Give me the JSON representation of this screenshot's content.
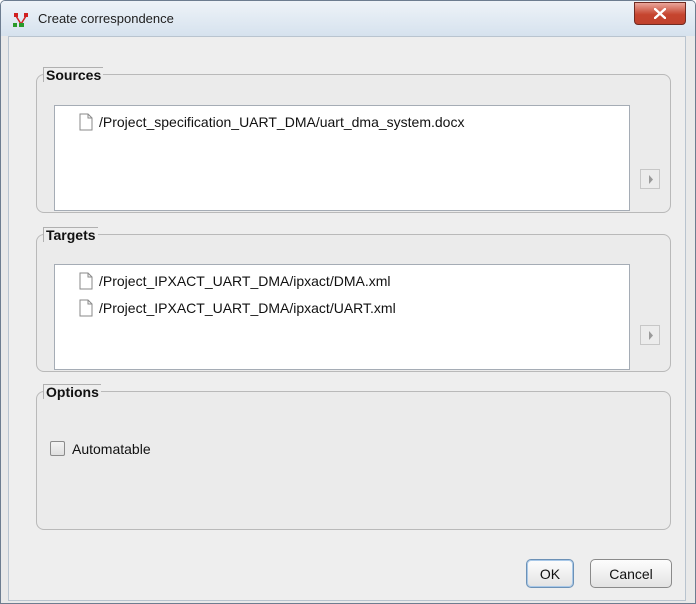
{
  "window": {
    "title": "Create correspondence",
    "close_label": "X"
  },
  "sources": {
    "legend": "Sources",
    "items": [
      {
        "label": "/Project_specification_UART_DMA/uart_dma_system.docx",
        "icon": "file-icon"
      }
    ]
  },
  "targets": {
    "legend": "Targets",
    "items": [
      {
        "label": "/Project_IPXACT_UART_DMA/ipxact/DMA.xml",
        "icon": "file-icon"
      },
      {
        "label": "/Project_IPXACT_UART_DMA/ipxact/UART.xml",
        "icon": "file-icon"
      }
    ]
  },
  "options": {
    "legend": "Options",
    "automatable_label": "Automatable",
    "automatable_checked": false
  },
  "buttons": {
    "ok": "OK",
    "cancel": "Cancel"
  }
}
